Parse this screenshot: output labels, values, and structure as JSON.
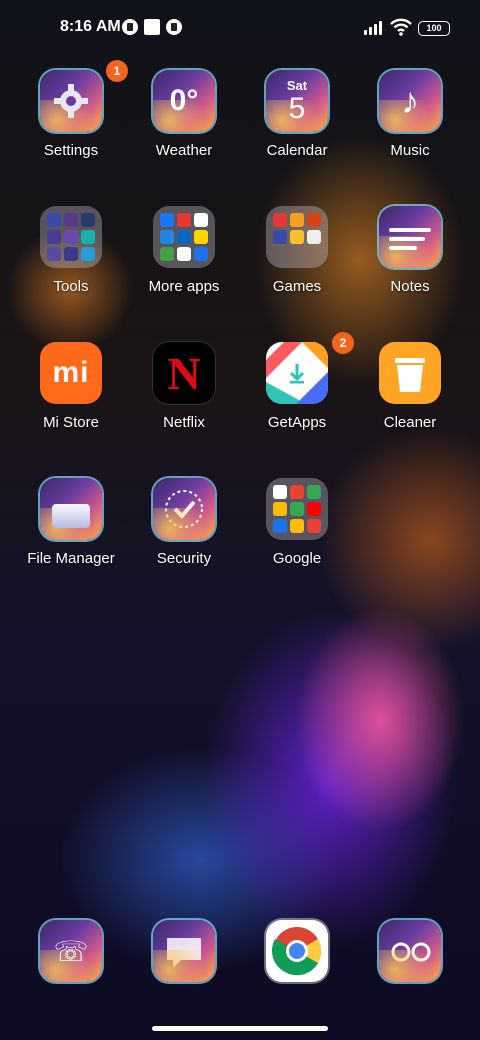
{
  "status_bar": {
    "time": "8:16 AM",
    "battery": "100",
    "icons": [
      "notification-icon",
      "notification-icon",
      "notification-icon",
      "signal-icon",
      "wifi-icon",
      "battery-icon"
    ]
  },
  "rows": [
    [
      {
        "name": "settings",
        "label": "Settings",
        "badge": "1",
        "icon": "gear-icon"
      },
      {
        "name": "weather",
        "label": "Weather",
        "icon_text": "0°",
        "icon": "weather-icon"
      },
      {
        "name": "calendar",
        "label": "Calendar",
        "icon_day": "Sat",
        "icon_date": "5",
        "icon": "calendar-icon"
      },
      {
        "name": "music",
        "label": "Music",
        "icon": "music-note-icon"
      }
    ],
    [
      {
        "name": "tools",
        "label": "Tools",
        "icon": "folder-icon"
      },
      {
        "name": "more-apps",
        "label": "More apps",
        "icon": "folder-icon"
      },
      {
        "name": "games",
        "label": "Games",
        "icon": "folder-icon"
      },
      {
        "name": "notes",
        "label": "Notes",
        "icon": "notes-icon"
      }
    ],
    [
      {
        "name": "mi-store",
        "label": "Mi Store",
        "icon_text": "mi",
        "icon": "mi-logo-icon"
      },
      {
        "name": "netflix",
        "label": "Netflix",
        "icon_text": "N",
        "icon": "netflix-logo-icon"
      },
      {
        "name": "getapps",
        "label": "GetApps",
        "badge": "2",
        "icon": "getapps-icon"
      },
      {
        "name": "cleaner",
        "label": "Cleaner",
        "icon": "trash-can-icon"
      }
    ],
    [
      {
        "name": "file-manager",
        "label": "File Manager",
        "icon": "folder-file-icon"
      },
      {
        "name": "security",
        "label": "Security",
        "icon": "shield-check-icon"
      },
      {
        "name": "google",
        "label": "Google",
        "icon": "folder-icon"
      }
    ]
  ],
  "dock": [
    {
      "name": "phone",
      "icon": "phone-icon"
    },
    {
      "name": "messages",
      "icon": "message-icon"
    },
    {
      "name": "chrome",
      "icon": "chrome-icon"
    },
    {
      "name": "camera",
      "icon": "camera-icon"
    }
  ],
  "colors": {
    "badge": "#f4641e",
    "mi_orange": "#ff6a1a",
    "netflix_red": "#e50914",
    "cleaner_orange": "#ffa526"
  }
}
